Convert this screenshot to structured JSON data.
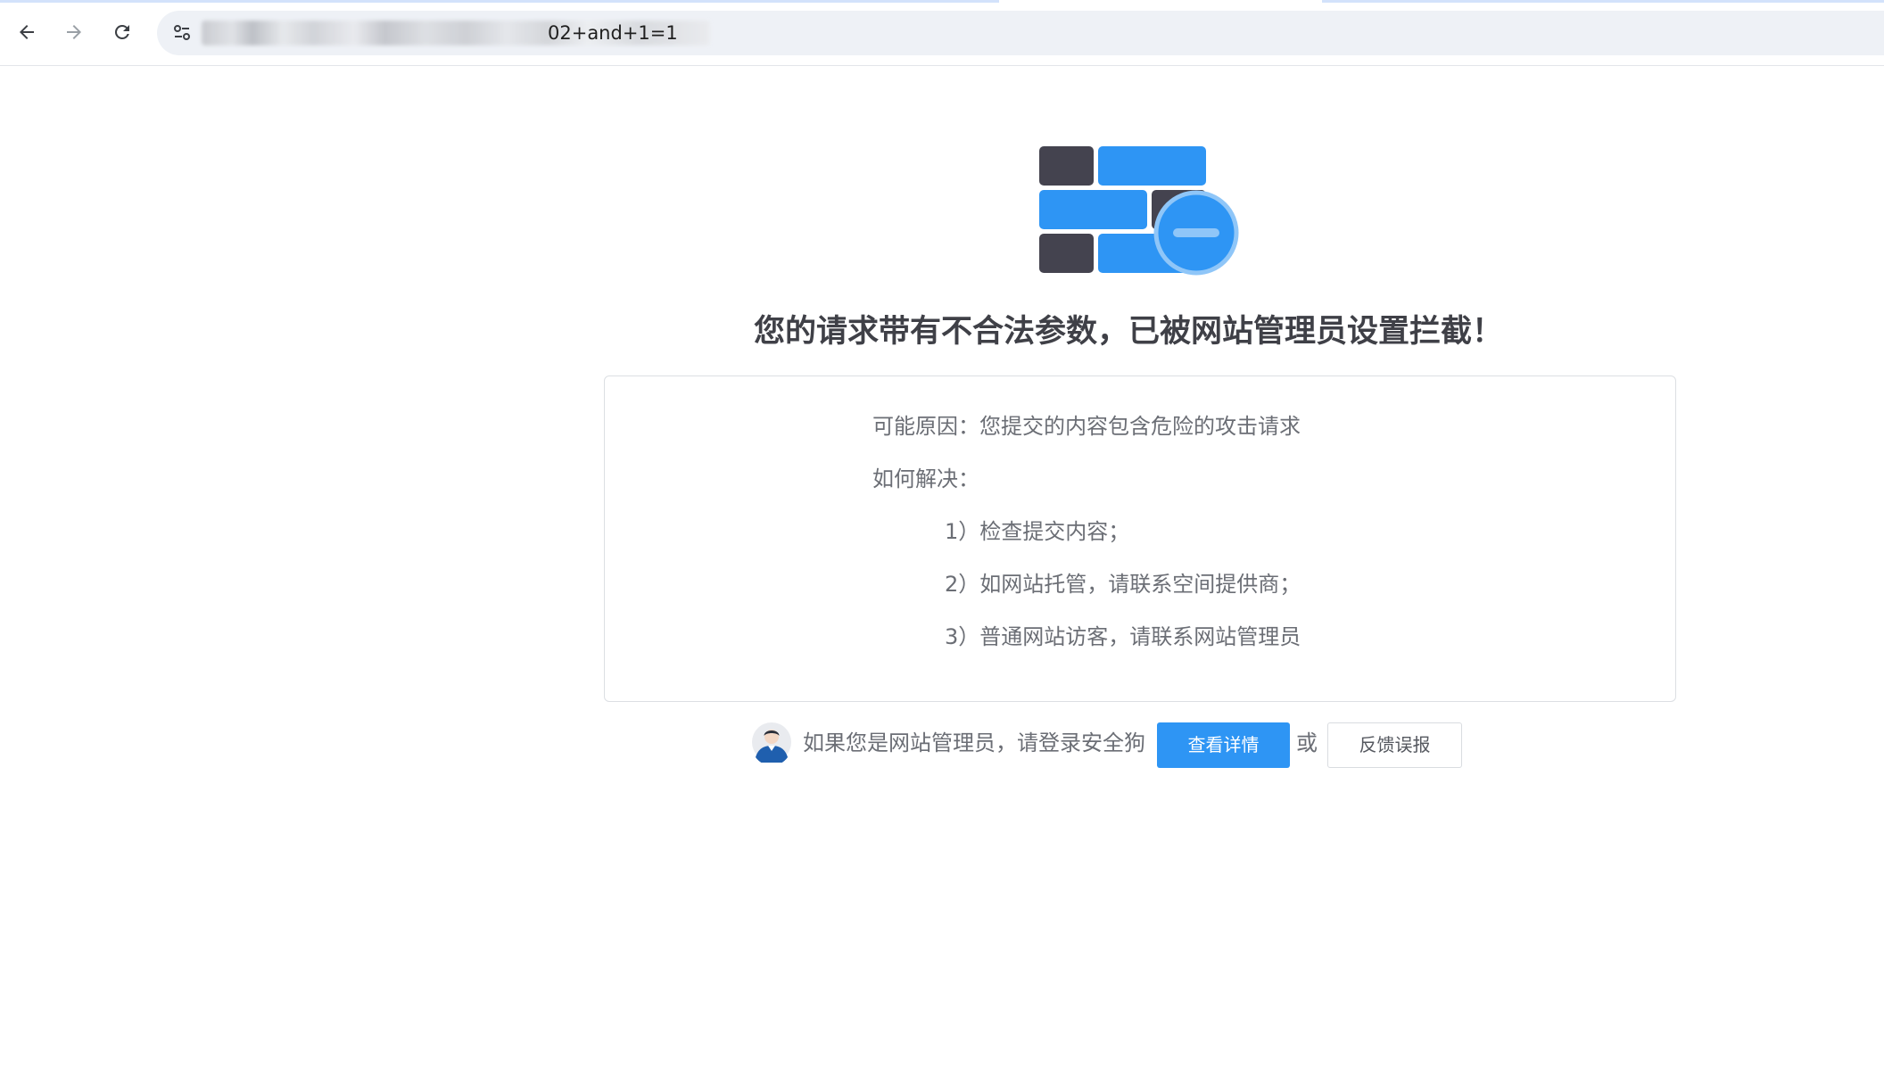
{
  "browser": {
    "url_visible_suffix": "02+and+1=1",
    "back_icon": "arrow-left-icon",
    "forward_icon": "arrow-right-icon",
    "reload_icon": "reload-icon",
    "site_info_icon": "tune-icon"
  },
  "page": {
    "headline": "您的请求带有不合法参数，已被网站管理员设置拦截！",
    "info": {
      "reason": "可能原因：您提交的内容包含危险的攻击请求",
      "how_to_fix": "如何解决：",
      "steps": [
        "1）检查提交内容；",
        "2）如网站托管，请联系空间提供商；",
        "3）普通网站访客，请联系网站管理员"
      ]
    },
    "footer": {
      "admin_prompt": "如果您是网站管理员，请登录安全狗",
      "details_button": "查看详情",
      "or": "或",
      "feedback_button": "反馈误报"
    }
  },
  "colors": {
    "accent_blue": "#2e95f4",
    "dark_brick": "#44434f",
    "headline_text": "#3f4047"
  }
}
